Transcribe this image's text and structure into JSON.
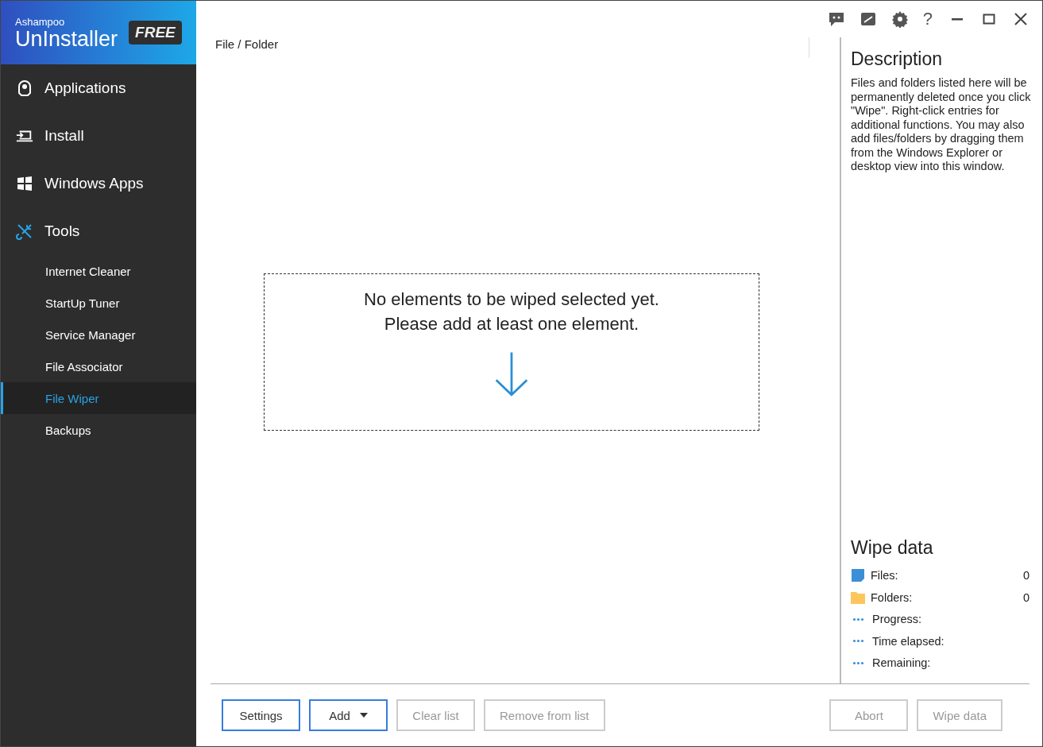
{
  "brand": {
    "company": "Ashampoo",
    "product": "UnInstaller",
    "badge": "FREE"
  },
  "nav": [
    {
      "label": "Applications",
      "kind": "disc",
      "selected": false
    },
    {
      "label": "Install",
      "kind": "install",
      "selected": false
    },
    {
      "label": "Windows Apps",
      "kind": "windows",
      "selected": false
    },
    {
      "label": "Tools",
      "kind": "tools",
      "selected": true,
      "children": [
        {
          "label": "Internet Cleaner",
          "selected": false
        },
        {
          "label": "StartUp Tuner",
          "selected": false
        },
        {
          "label": "Service Manager",
          "selected": false
        },
        {
          "label": "File Associator",
          "selected": false
        },
        {
          "label": "File Wiper",
          "selected": true
        },
        {
          "label": "Backups",
          "selected": false
        }
      ]
    }
  ],
  "title_bar": {
    "help": "?"
  },
  "breadcrumb": "File / Folder",
  "empty_message": [
    "No elements to be wiped selected yet.",
    "Please add at least one element."
  ],
  "description": {
    "title": "Description",
    "text": "Files and folders listed here will be permanently deleted once you click \"Wipe\". Right-click entries for additional functions. You may also add files/folders by dragging them from the Windows Explorer or desktop view into this window."
  },
  "wipe_data": {
    "title": "Wipe data",
    "rows": [
      {
        "kind": "file",
        "label": "Files:",
        "value": "0"
      },
      {
        "kind": "folder",
        "label": "Folders:",
        "value": "0"
      },
      {
        "kind": "pending",
        "label": "Progress:"
      },
      {
        "kind": "pending",
        "label": "Time elapsed:"
      },
      {
        "kind": "pending",
        "label": "Remaining:"
      }
    ]
  },
  "buttons_left": [
    {
      "label": "Settings",
      "disabled": false,
      "dropdown": false
    },
    {
      "label": "Add",
      "disabled": false,
      "dropdown": true
    },
    {
      "label": "Clear list",
      "disabled": true,
      "dropdown": false
    },
    {
      "label": "Remove from list",
      "disabled": true,
      "dropdown": false
    }
  ],
  "buttons_right": [
    {
      "label": "Abort",
      "disabled": true
    },
    {
      "label": "Wipe data",
      "disabled": true
    }
  ]
}
